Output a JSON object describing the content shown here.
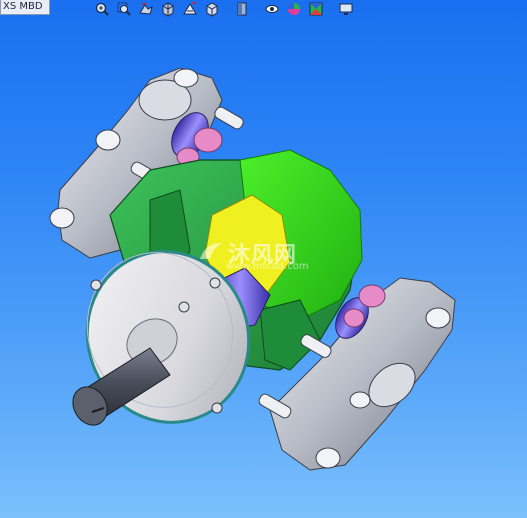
{
  "tab": {
    "label": "XS MBD"
  },
  "toolbar": {
    "buttons": [
      {
        "name": "zoom-to-fit-icon"
      },
      {
        "name": "zoom-area-icon"
      },
      {
        "name": "previous-view-icon"
      },
      {
        "name": "section-view-icon"
      },
      {
        "name": "dynamic-annotation-icon"
      },
      {
        "name": "view-orientation-icon"
      },
      {
        "name": "display-style-icon"
      },
      {
        "name": "hide-show-items-icon"
      },
      {
        "name": "edit-appearance-icon"
      },
      {
        "name": "apply-scene-icon"
      },
      {
        "name": "view-settings-icon"
      }
    ]
  },
  "watermark": {
    "text": "沐风网",
    "url": "www.mfcad.com"
  },
  "colors": {
    "background_top": "#1a6ff0",
    "background_bottom": "#7cc0fc",
    "housing_green": "#2fa84a",
    "bright_green": "#33e01a",
    "yellow": "#f0f020",
    "steel": "#c8ccd4",
    "pink": "#e68ac8",
    "violet": "#7a6af0"
  }
}
